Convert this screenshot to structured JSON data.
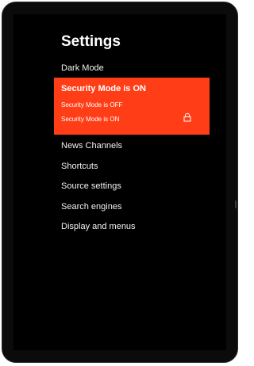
{
  "settings": {
    "title": "Settings",
    "items": [
      {
        "label": "Dark Mode"
      },
      {
        "label": "News Channels"
      },
      {
        "label": "Shortcuts"
      },
      {
        "label": "Source settings"
      },
      {
        "label": "Search engines"
      },
      {
        "label": "Display and menus"
      }
    ],
    "security_dropdown": {
      "selected": "Security Mode is ON",
      "options": [
        {
          "label": "Security Mode is OFF"
        },
        {
          "label": "Security Mode is ON",
          "icon": "lock-icon"
        }
      ],
      "accent_color": "#ff3d17"
    }
  }
}
